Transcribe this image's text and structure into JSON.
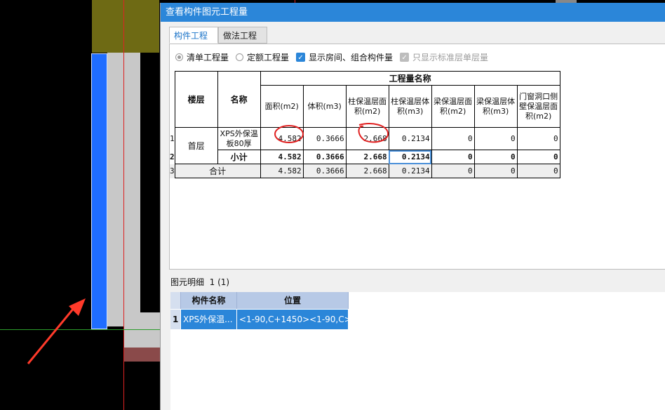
{
  "dialog": {
    "title": "查看构件图元工程量",
    "tabs": [
      "构件工程量",
      "做法工程量"
    ],
    "options": [
      {
        "label": "清单工程量",
        "type": "radio",
        "checked": true,
        "enabled": true
      },
      {
        "label": "定额工程量",
        "type": "radio",
        "checked": false,
        "enabled": true
      },
      {
        "label": "显示房间、组合构件量",
        "type": "checkbox",
        "checked": true,
        "enabled": true
      },
      {
        "label": "只显示标准层单层量",
        "type": "checkbox",
        "checked": true,
        "enabled": false
      }
    ],
    "grid": {
      "group_header": "工程量名称",
      "col_floor": "楼层",
      "col_name": "名称",
      "columns": [
        "面积(m2)",
        "体积(m3)",
        "柱保温层面积(m2)",
        "柱保温层体积(m3)",
        "梁保温层面积(m2)",
        "梁保温层体积(m3)",
        "门窗洞口侧壁保温层面积(m2)"
      ],
      "rows": [
        {
          "num": "1",
          "floor": "首层",
          "name": "XPS外保温板80厚",
          "values": [
            "4.582",
            "0.3666",
            "2.668",
            "0.2134",
            "0",
            "0",
            "0"
          ]
        },
        {
          "num": "2",
          "floor": "",
          "name": "小计",
          "values": [
            "4.582",
            "0.3666",
            "2.668",
            "0.2134",
            "0",
            "0",
            "0"
          ]
        },
        {
          "num": "3",
          "floor": "",
          "name": "合计",
          "values": [
            "4.582",
            "0.3666",
            "2.668",
            "0.2134",
            "0",
            "0",
            "0"
          ]
        }
      ]
    },
    "detail": {
      "label": "图元明细",
      "count": "1 (1)",
      "headers": [
        "构件名称",
        "位置"
      ],
      "rows": [
        {
          "num": "1",
          "name": "XPS外保温...",
          "position": "<1-90,C+1450><1-90,C>"
        }
      ]
    }
  },
  "colors": {
    "title_bar": "#2b86d9",
    "selected_row": "#2b86d9",
    "annotation": "#e02020",
    "cad_blue": "#1f6dff"
  }
}
